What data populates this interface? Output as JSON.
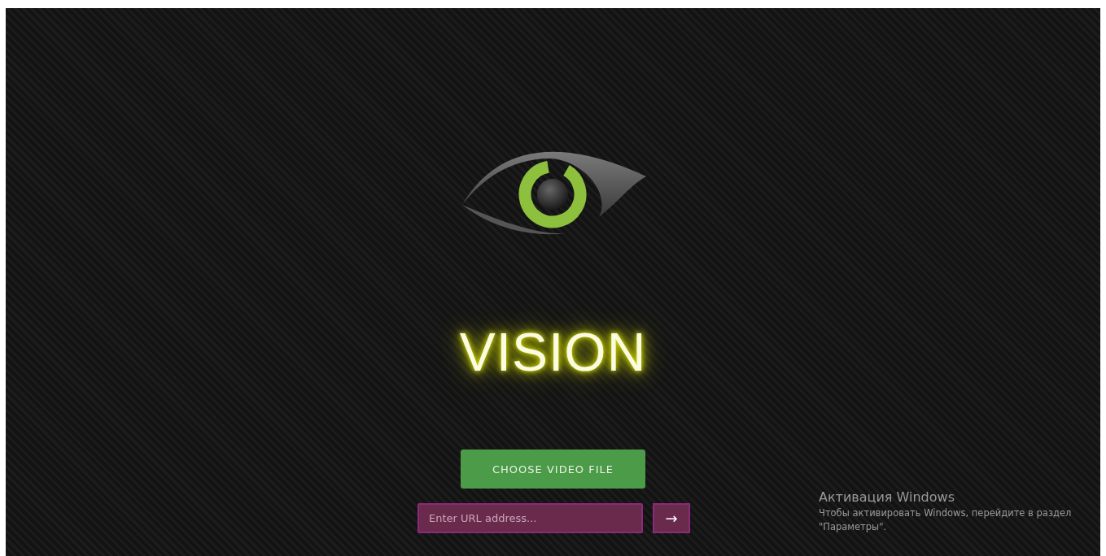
{
  "brand": {
    "title": "VISION"
  },
  "upload_button": {
    "label": "CHOOSE VIDEO FILE"
  },
  "url_field": {
    "placeholder": "Enter URL address...",
    "submit_label": "→"
  },
  "activation_notice": {
    "title": "Активация Windows",
    "message": "Чтобы активировать Windows, перейдите в раздел \"Параметры\"."
  }
}
